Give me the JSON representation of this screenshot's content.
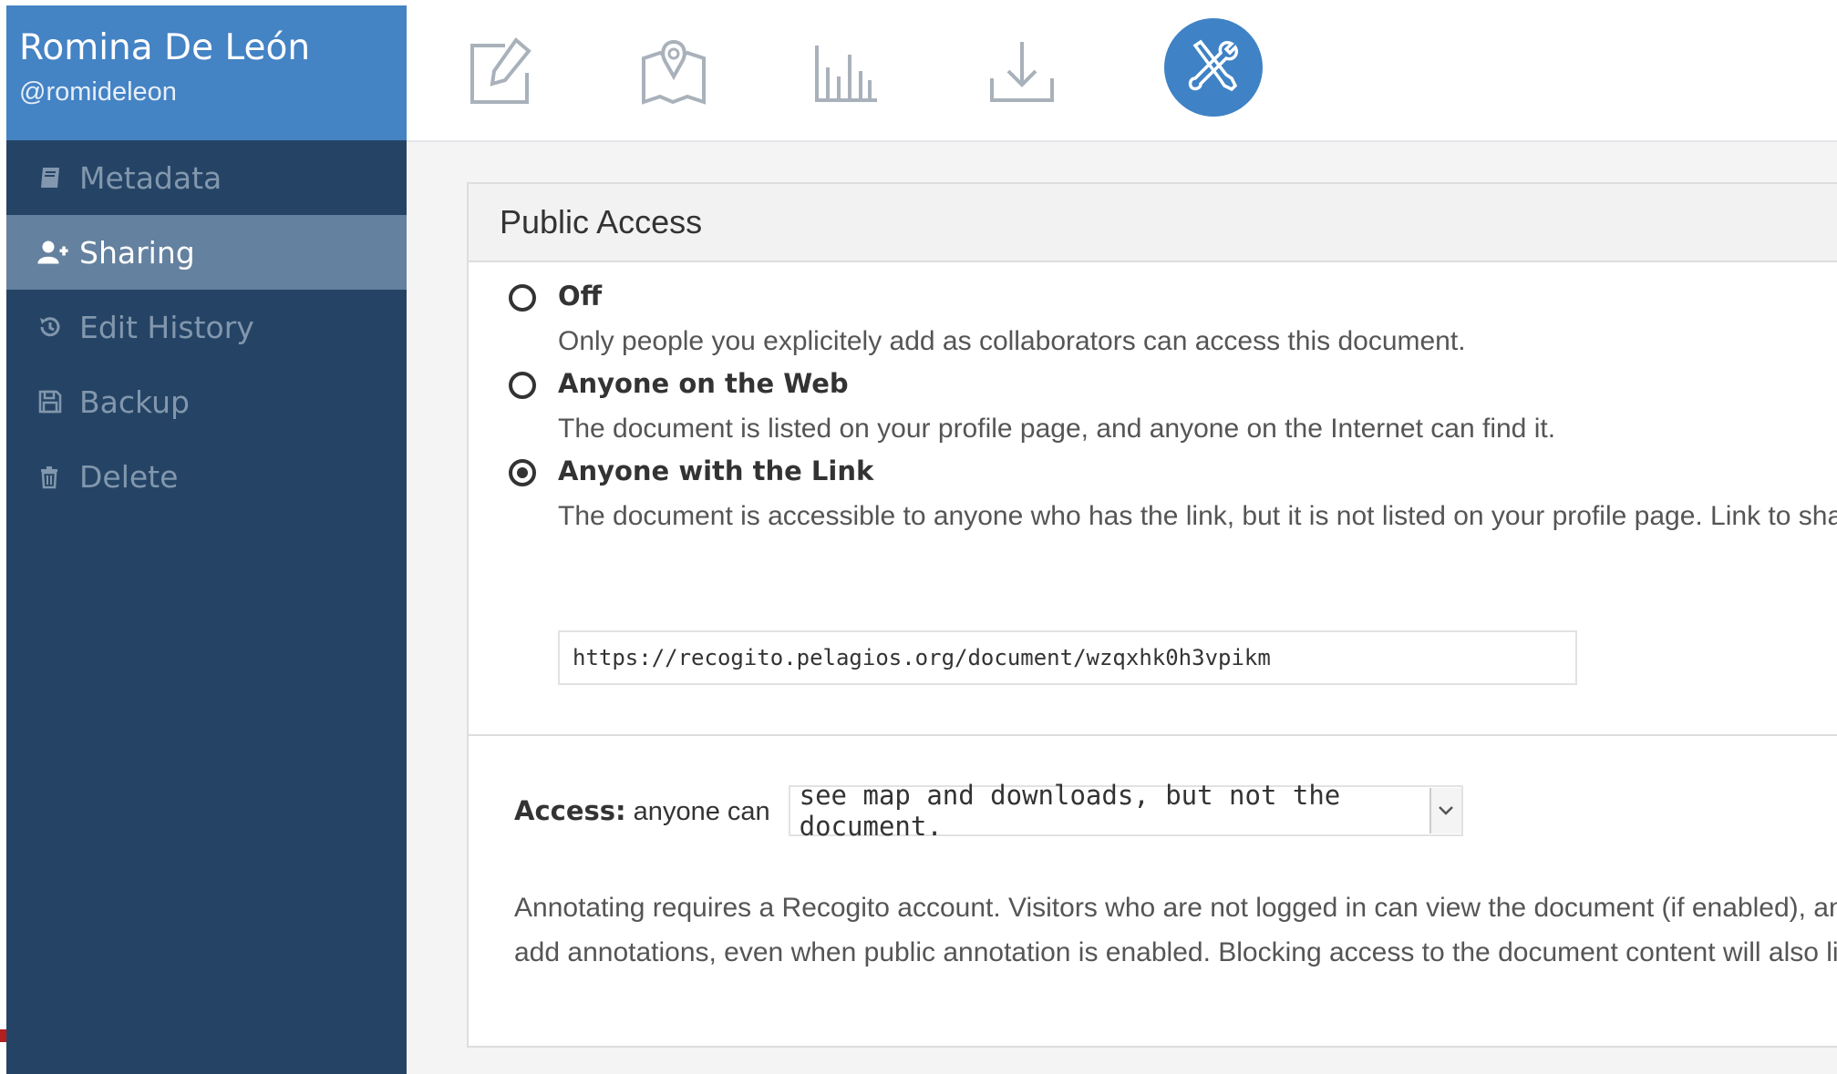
{
  "user": {
    "name": "Romina De León",
    "handle": "@romideleon"
  },
  "sidebar": {
    "items": [
      {
        "label": "Metadata",
        "icon": "book-icon"
      },
      {
        "label": "Sharing",
        "icon": "add-user-icon",
        "active": true
      },
      {
        "label": "Edit History",
        "icon": "history-icon"
      },
      {
        "label": "Backup",
        "icon": "floppy-icon"
      },
      {
        "label": "Delete",
        "icon": "trash-icon"
      }
    ]
  },
  "toolbar": {
    "tools": [
      "edit-icon",
      "map-icon",
      "stats-icon",
      "download-icon",
      "settings-tools-icon"
    ],
    "active": "settings-tools-icon"
  },
  "panel": {
    "title": "Public Access",
    "options": [
      {
        "title": "Off",
        "desc": "Only people you explicitely add as collaborators can access this document.",
        "checked": false
      },
      {
        "title": "Anyone on the Web",
        "desc": "The document is listed on your profile page, and anyone on the Internet can find it.",
        "checked": false
      },
      {
        "title": "Anyone with the Link",
        "desc": "The document is accessible to anyone who has the link, but it is not listed on your profile page. Link to share:",
        "checked": true
      }
    ],
    "share_link": "https://recogito.pelagios.org/document/wzqxhk0h3vpikm",
    "access": {
      "label_bold": "Access:",
      "label_rest": " anyone can",
      "selected": "see map and downloads, but not the document."
    },
    "note_line1": "Annotating requires a Recogito account. Visitors who are not logged in can view the document (if enabled), and downl",
    "note_line2": "add annotations, even when public annotation is enabled. Blocking access to the document content will also limit som"
  },
  "colors": {
    "sidebar": "#254465",
    "user_block": "#4483c4",
    "active_nav": "#64819f",
    "accent": "#3f82c5"
  }
}
